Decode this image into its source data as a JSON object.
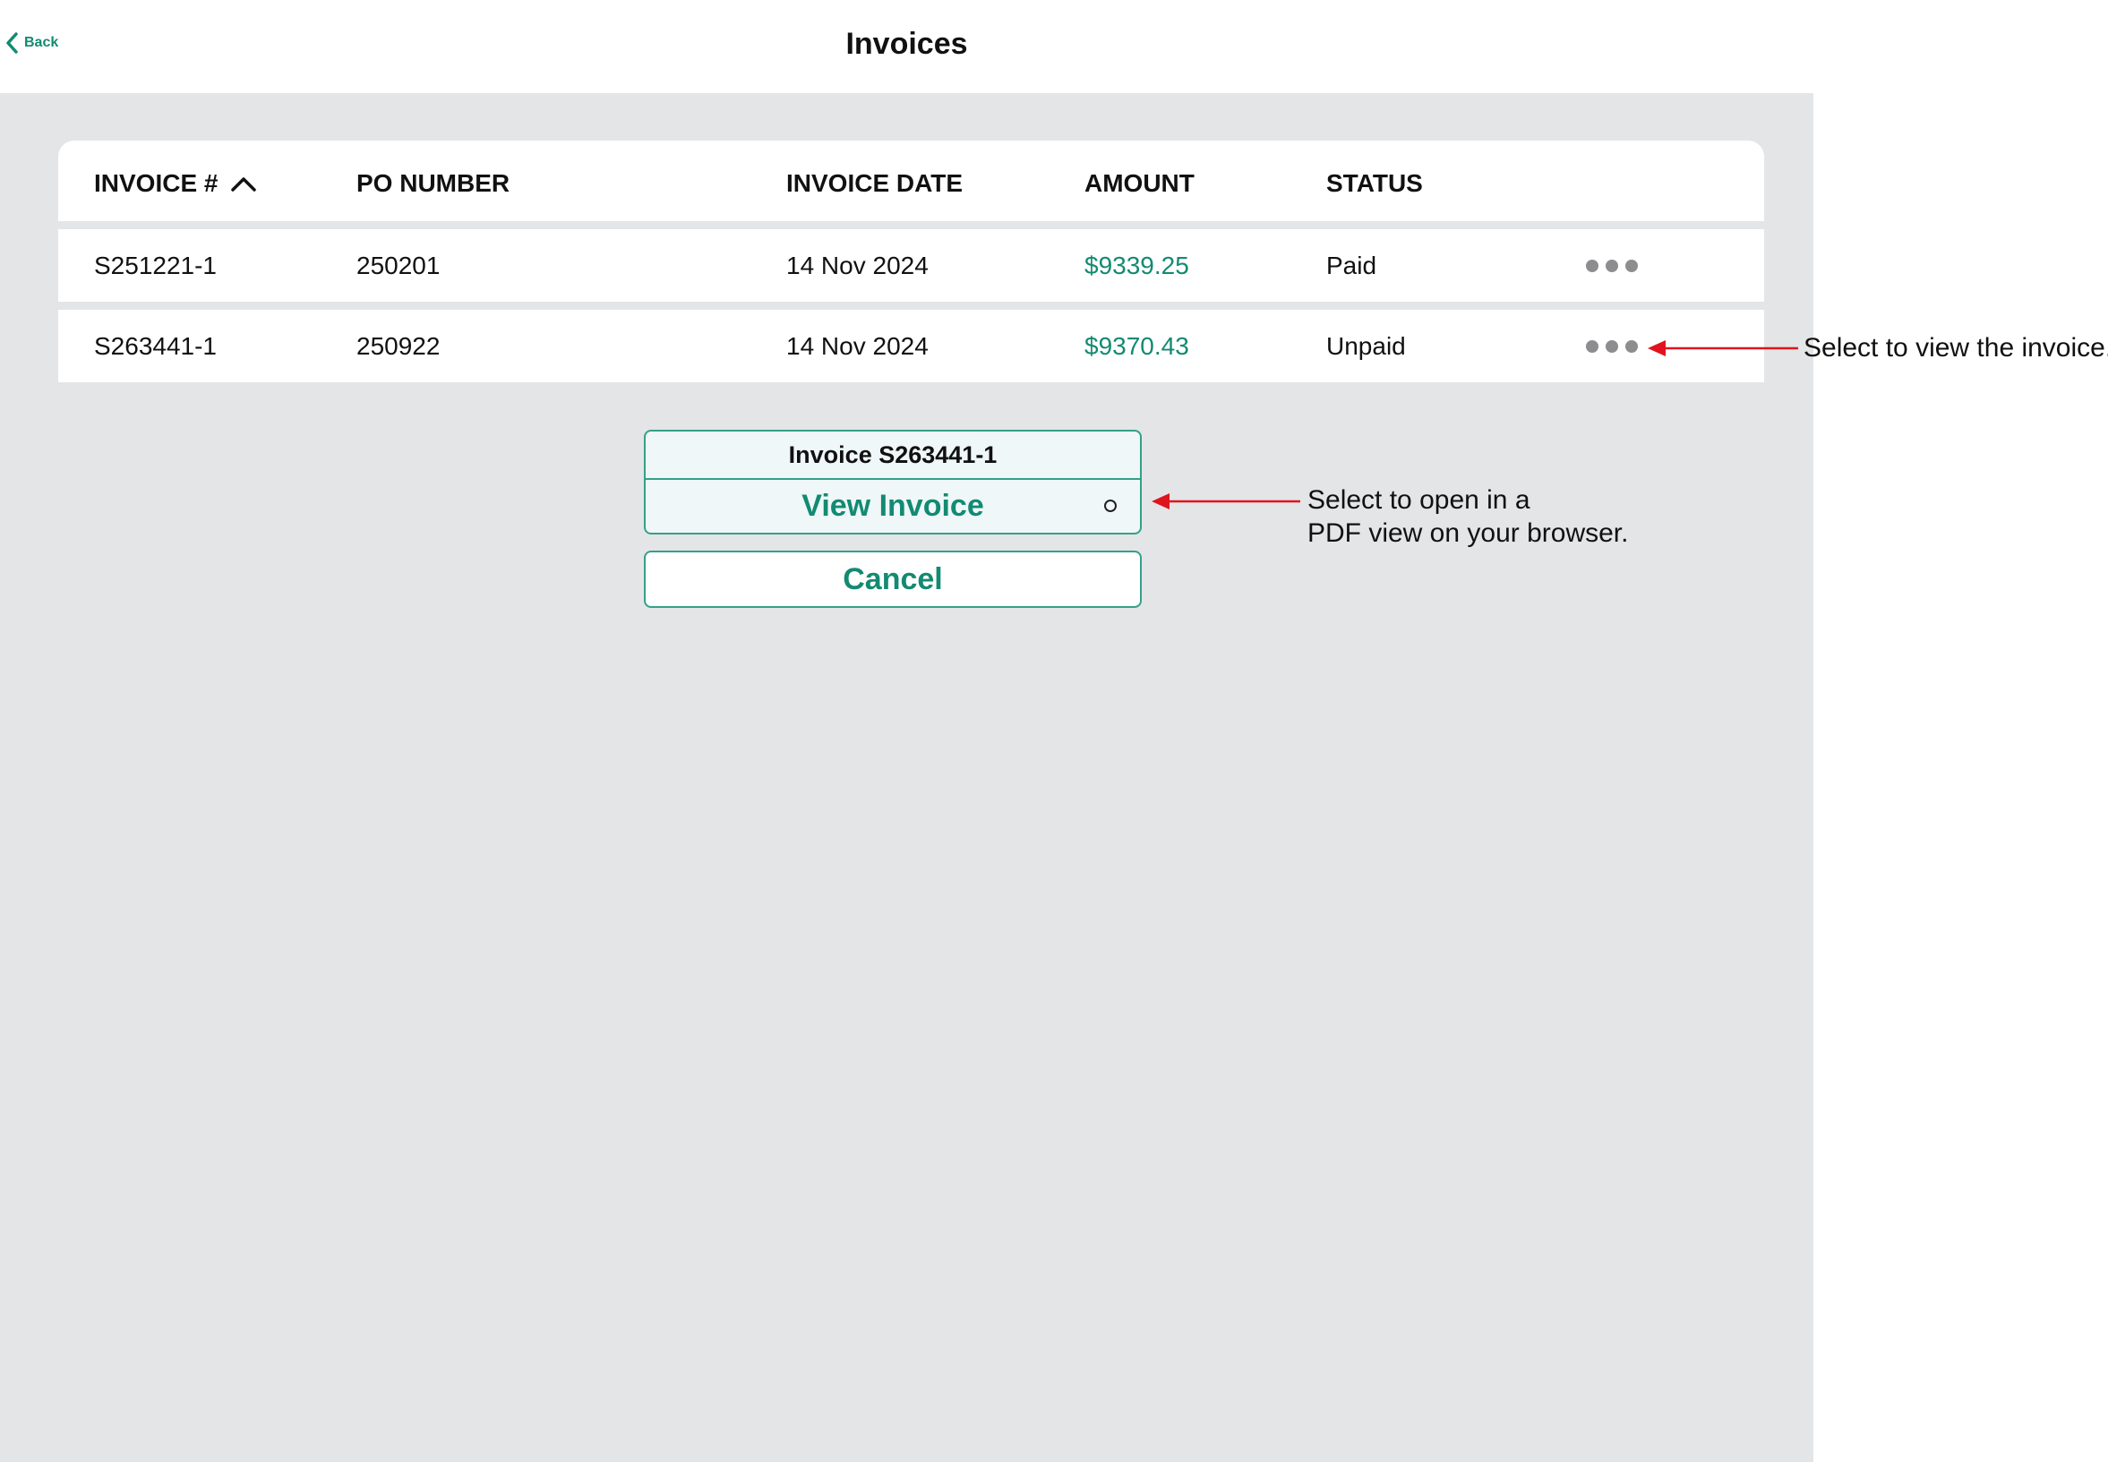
{
  "header": {
    "back_label": "Back",
    "title": "Invoices"
  },
  "table": {
    "columns": [
      "INVOICE #",
      "PO NUMBER",
      "INVOICE DATE",
      "AMOUNT",
      "STATUS"
    ],
    "sort": {
      "column": "INVOICE #",
      "direction": "ascending",
      "icon": "chevron-up-icon"
    },
    "rows": [
      {
        "invoice": "S251221-1",
        "po": "250201",
        "date": "14 Nov 2024",
        "amount": "$9339.25",
        "status": "Paid"
      },
      {
        "invoice": "S263441-1",
        "po": "250922",
        "date": "14 Nov 2024",
        "amount": "$9370.43",
        "status": "Unpaid"
      }
    ],
    "row_action_icon": "more-dots-icon"
  },
  "action_sheet": {
    "title": "Invoice S263441-1",
    "view_label": "View Invoice",
    "cancel_label": "Cancel"
  },
  "annotations": {
    "row_menu": "Select to view the invoice.",
    "view_line1": "Select to open in a",
    "view_line2": "PDF view on your browser."
  },
  "colors": {
    "accent": "#138a72",
    "background": "#e4e5e7",
    "annotation_arrow": "#e0141e",
    "sheet_fill": "#eff7f8"
  }
}
